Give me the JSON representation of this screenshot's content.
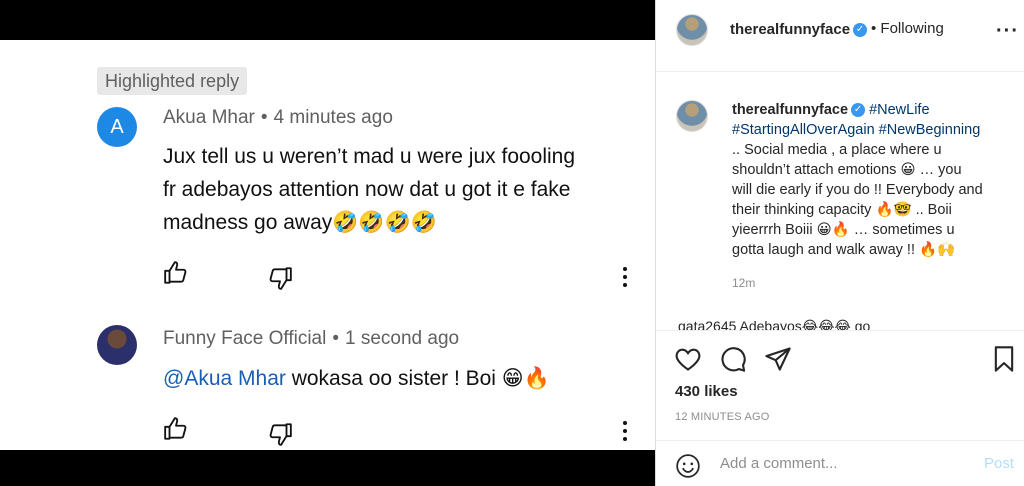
{
  "youtube": {
    "highlighted_label": "Highlighted reply",
    "comments": [
      {
        "avatar_letter": "A",
        "author": "Akua Mhar",
        "time": "4 minutes ago",
        "lines": [
          "Jux tell us u weren’t mad u were jux foooling",
          "fr adebayos attention now dat u got it e fake",
          "madness go away🤣🤣🤣🤣"
        ]
      },
      {
        "author": "Funny Face Official",
        "time": "1 second ago",
        "mention": "@Akua Mhar",
        "text": " wokasa oo sister ! Boi 😁🔥"
      }
    ],
    "separator": "•",
    "icons": [
      "thumbs-up-icon",
      "thumbs-down-icon",
      "more-vert-icon"
    ]
  },
  "instagram": {
    "username": "therealfunnyface",
    "following": "• Following",
    "verified_icon": "verified-badge-icon",
    "more_icon": "more-horizontal-icon",
    "caption": {
      "user": "therealfunnyface",
      "hashtags_line1": "#NewLife",
      "hashtags_line2": "#StartingAllOverAgain #NewBeginning",
      "lines": [
        ".. Social media , a place where u",
        "shouldn’t attach emotions 😀 … you",
        "will die early if you do !! Everybody and",
        "their thinking capacity 🔥🤓 .. Boii",
        "yieerrrh Boiii 😀🔥 … sometimes u",
        "gotta laugh and walk away !! 🔥🙌"
      ],
      "time": "12m"
    },
    "peek_text": "gata2645 Adebayos😂😂😂 go",
    "likes": "430 likes",
    "ago": "12 MINUTES AGO",
    "add_comment_placeholder": "Add a comment...",
    "post_label": "Post",
    "colors": {
      "link": "#00376b",
      "verified": "#3897f0",
      "post_disabled": "#b2dffc"
    }
  }
}
